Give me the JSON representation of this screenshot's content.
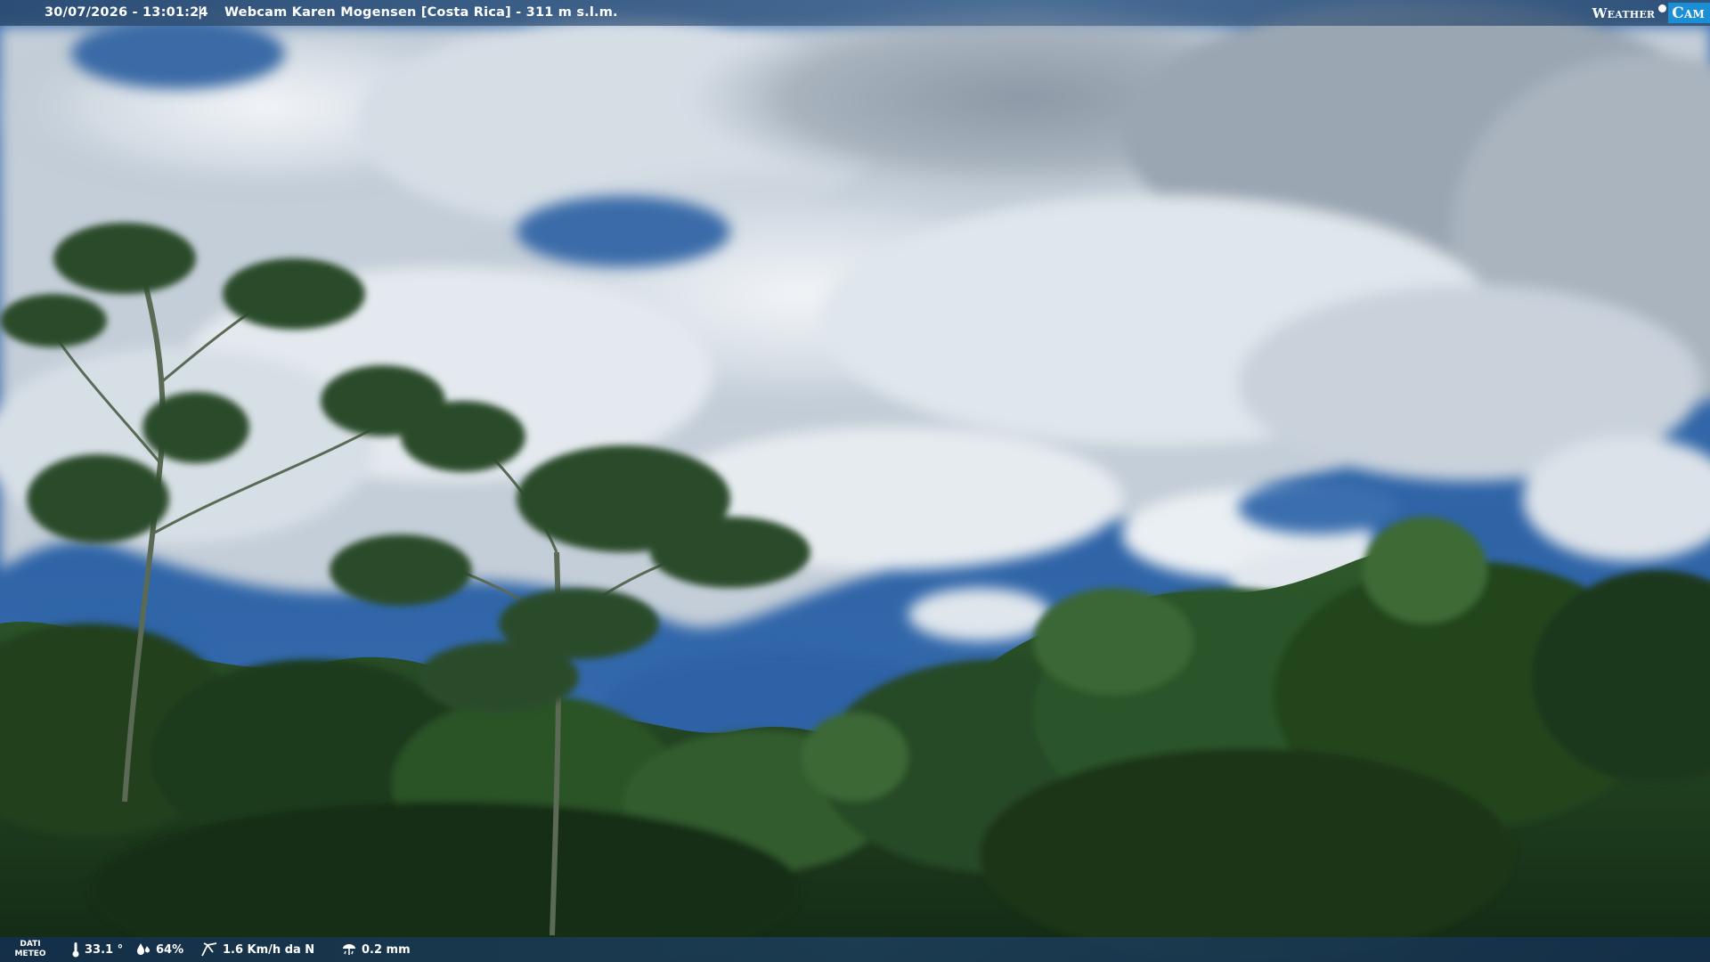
{
  "header": {
    "timestamp": "30/07/2026 - 13:01:24",
    "separator": "|",
    "title": "Webcam Karen Mogensen [Costa Rica] - 311 m s.l.m.",
    "logo": {
      "left": "Weather",
      "right": "Cam"
    }
  },
  "footer": {
    "label_line1": "DATI",
    "label_line2": "METEO",
    "temperature": "33.1 °",
    "humidity": "64%",
    "wind": "1.6 Km/h da N",
    "rain": "0.2 mm"
  },
  "colors": {
    "sky": "#2a5d9c",
    "cloud": "#e9eef3",
    "foliage_dark": "#16301a",
    "foliage_mid": "#2f5a2c",
    "logo_accent": "#1b8fd6"
  },
  "icons": [
    "thermometer-icon",
    "humidity-icon",
    "wind-icon",
    "rain-gauge-icon"
  ]
}
